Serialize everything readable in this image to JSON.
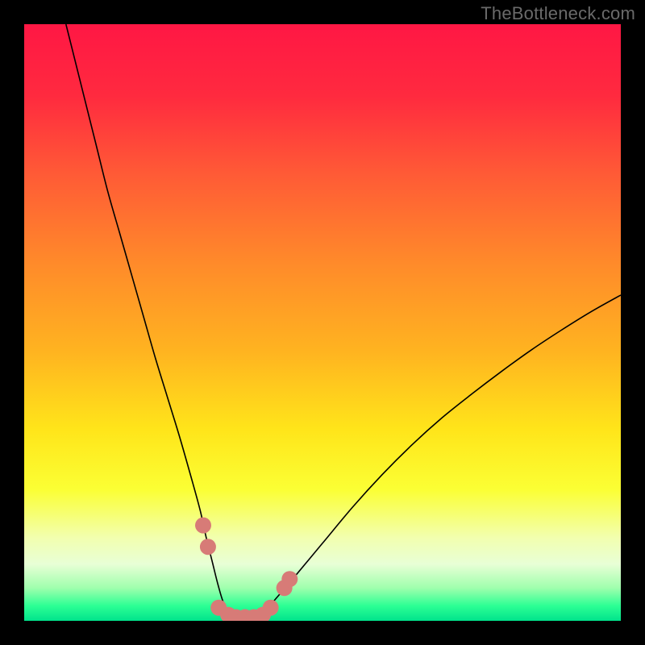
{
  "watermark": "TheBottleneck.com",
  "chart_data": {
    "type": "line",
    "title": "",
    "xlabel": "",
    "ylabel": "",
    "xlim": [
      0,
      100
    ],
    "ylim": [
      0,
      100
    ],
    "grid": false,
    "legend": false,
    "background_gradient": {
      "stops": [
        {
          "pos": 0.0,
          "color": "#ff1744"
        },
        {
          "pos": 0.12,
          "color": "#ff2a3f"
        },
        {
          "pos": 0.25,
          "color": "#ff5a36"
        },
        {
          "pos": 0.4,
          "color": "#ff8a2a"
        },
        {
          "pos": 0.55,
          "color": "#ffb420"
        },
        {
          "pos": 0.68,
          "color": "#ffe51a"
        },
        {
          "pos": 0.78,
          "color": "#fbff34"
        },
        {
          "pos": 0.86,
          "color": "#f2ffae"
        },
        {
          "pos": 0.905,
          "color": "#e8ffd6"
        },
        {
          "pos": 0.945,
          "color": "#9fffad"
        },
        {
          "pos": 0.975,
          "color": "#2cff94"
        },
        {
          "pos": 1.0,
          "color": "#00e38c"
        }
      ]
    },
    "series": [
      {
        "name": "bottleneck-curve",
        "color": "#000000",
        "x": [
          7,
          8,
          10,
          12,
          14,
          16,
          18,
          20,
          22,
          24,
          26,
          28,
          29.5,
          30.5,
          31.5,
          32.5,
          33.5,
          35,
          37,
          38,
          39,
          40,
          42,
          45,
          50,
          55,
          60,
          65,
          70,
          75,
          80,
          85,
          90,
          95,
          100
        ],
        "y": [
          100,
          96,
          88,
          80,
          72,
          65,
          58,
          51,
          44,
          37.5,
          31,
          24,
          18.5,
          14,
          10,
          6,
          2.8,
          0.4,
          0,
          0,
          0.3,
          1.2,
          3.5,
          7,
          13,
          19,
          24.5,
          29.5,
          34,
          38,
          41.8,
          45.4,
          48.7,
          51.8,
          54.6
        ]
      }
    ],
    "markers": {
      "name": "highlight-dots",
      "color": "#d77b77",
      "radius_px": 10,
      "points": [
        {
          "x": 30.0,
          "y": 16.0
        },
        {
          "x": 30.8,
          "y": 12.4
        },
        {
          "x": 32.6,
          "y": 2.2
        },
        {
          "x": 34.2,
          "y": 1.0
        },
        {
          "x": 35.5,
          "y": 0.6
        },
        {
          "x": 37.0,
          "y": 0.6
        },
        {
          "x": 38.5,
          "y": 0.6
        },
        {
          "x": 40.0,
          "y": 1.0
        },
        {
          "x": 41.3,
          "y": 2.2
        },
        {
          "x": 43.6,
          "y": 5.5
        },
        {
          "x": 44.5,
          "y": 7.0
        }
      ]
    }
  }
}
